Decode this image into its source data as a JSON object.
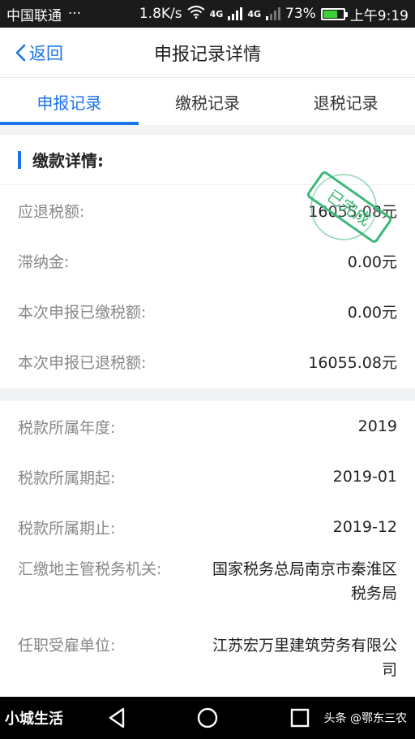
{
  "status": {
    "carrier": "中国联通",
    "dots": "···",
    "speed": "1.8K/s",
    "net1": "4G",
    "net2": "4G",
    "battery": "73%",
    "time": "上午9:19"
  },
  "nav": {
    "back_label": "返回",
    "title": "申报记录详情"
  },
  "tabs": [
    {
      "label": "申报记录",
      "active": true
    },
    {
      "label": "缴税记录",
      "active": false
    },
    {
      "label": "退税记录",
      "active": false
    }
  ],
  "payment_section": {
    "title": "缴款详情:",
    "rows": [
      {
        "label": "应退税额:",
        "value": "16055.08元"
      },
      {
        "label": "滞纳金:",
        "value": "0.00元"
      },
      {
        "label": "本次申报已缴税额:",
        "value": "0.00元"
      },
      {
        "label": "本次申报已退税额:",
        "value": "16055.08元"
      }
    ]
  },
  "stamp": {
    "text": "已完成",
    "color": "#3cb878"
  },
  "detail_section": {
    "rows": [
      {
        "label": "税款所属年度:",
        "value": "2019"
      },
      {
        "label": "税款所属期起:",
        "value": "2019-01"
      },
      {
        "label": "税款所属期止:",
        "value": "2019-12"
      },
      {
        "label": "汇缴地主管税务机关:",
        "value": "国家税务总局南京市秦淮区税务局"
      },
      {
        "label": "任职受雇单位:",
        "value": "江苏宏万里建筑劳务有限公司"
      }
    ]
  },
  "watermark": {
    "left": "小城生活",
    "right": "头条 @鄂东三农"
  },
  "colors": {
    "accent": "#1a73e8",
    "stamp": "#3cb878"
  }
}
